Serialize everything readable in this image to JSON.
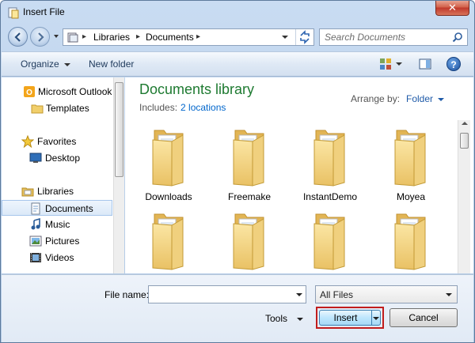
{
  "window": {
    "title": "Insert File",
    "close_symbol": "✕"
  },
  "address_bar": {
    "crumbs": [
      "Libraries",
      "Documents"
    ],
    "separator": "▸"
  },
  "search": {
    "placeholder": "Search Documents"
  },
  "toolbar": {
    "organize": "Organize",
    "new_folder": "New folder",
    "help": "?"
  },
  "sidebar": {
    "items": [
      {
        "label": "Microsoft Outlook",
        "icon": "outlook-icon"
      },
      {
        "label": "Templates",
        "icon": "folder-icon"
      },
      {
        "label": "Favorites",
        "icon": "star-icon"
      },
      {
        "label": "Desktop",
        "icon": "desktop-icon"
      },
      {
        "label": "Libraries",
        "icon": "libraries-icon"
      },
      {
        "label": "Documents",
        "icon": "documents-icon",
        "selected": true
      },
      {
        "label": "Music",
        "icon": "music-icon"
      },
      {
        "label": "Pictures",
        "icon": "pictures-icon"
      },
      {
        "label": "Videos",
        "icon": "videos-icon"
      }
    ]
  },
  "library": {
    "title": "Documents library",
    "includes_label": "Includes:",
    "includes_link": "2 locations",
    "arrange_label": "Arrange by:",
    "arrange_value": "Folder"
  },
  "folders": [
    "Downloads",
    "Freemake",
    "InstantDemo",
    "Moyea",
    "",
    "",
    "",
    ""
  ],
  "footer": {
    "filename_label": "File name:",
    "filename_value": "",
    "filetype": "All Files",
    "tools": "Tools",
    "insert": "Insert",
    "cancel": "Cancel"
  },
  "colors": {
    "library_title": "#1e7a31",
    "link": "#0066cc",
    "highlight_border": "#c11d1d"
  }
}
